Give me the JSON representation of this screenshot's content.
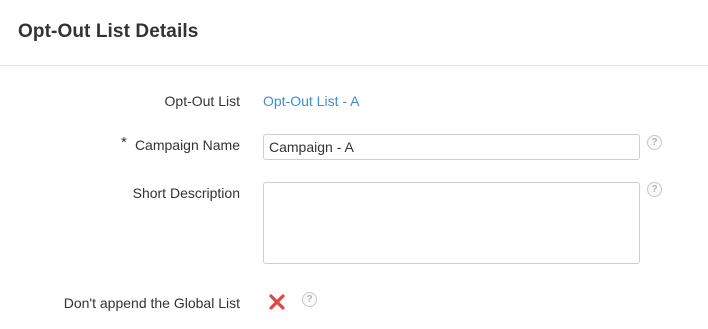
{
  "header": {
    "title": "Opt-Out List Details"
  },
  "form": {
    "opt_out_list": {
      "label": "Opt-Out List",
      "value": "Opt-Out List - A"
    },
    "campaign_name": {
      "required_marker": "*",
      "label": "Campaign Name",
      "value": "Campaign - A",
      "help_icon": "question-circle-icon"
    },
    "short_description": {
      "label": "Short Description",
      "value": "",
      "help_icon": "question-circle-icon"
    },
    "dont_append_global": {
      "label": "Don't append the Global List",
      "state_icon": "red-x-icon",
      "checked": false,
      "help_icon": "question-circle-icon"
    }
  },
  "colors": {
    "link": "#3d8ed1",
    "x_icon": "#e0483f",
    "divider": "#e3e3e3"
  },
  "help_glyph": "?"
}
